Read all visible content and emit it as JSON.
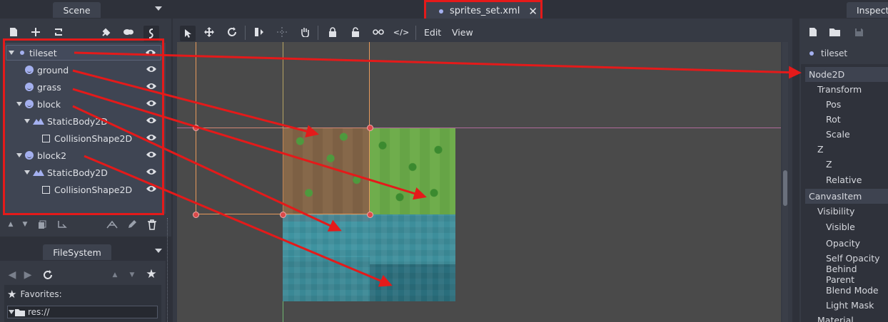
{
  "scene_dock": {
    "tab_label": "Scene",
    "tree": [
      {
        "label": "tileset",
        "icon": "node2d-icon"
      },
      {
        "label": "ground",
        "icon": "sprite-icon"
      },
      {
        "label": "grass",
        "icon": "sprite-icon"
      },
      {
        "label": "block",
        "icon": "sprite-icon"
      },
      {
        "label": "StaticBody2D",
        "icon": "staticbody-icon"
      },
      {
        "label": "CollisionShape2D",
        "icon": "collisionshape-icon"
      },
      {
        "label": "block2",
        "icon": "sprite-icon"
      },
      {
        "label": "StaticBody2D",
        "icon": "staticbody-icon"
      },
      {
        "label": "CollisionShape2D",
        "icon": "collisionshape-icon"
      }
    ]
  },
  "filesystem_dock": {
    "tab_label": "FileSystem",
    "favorites_label": "Favorites:",
    "root_path": "res://"
  },
  "editor": {
    "file_tab": "sprites_set.xml",
    "menus": [
      "Edit",
      "View"
    ]
  },
  "inspector": {
    "tab_label": "Inspect",
    "node_name": "tileset",
    "rows": [
      {
        "label": "Node2D",
        "kind": "category"
      },
      {
        "label": "Transform",
        "kind": "group"
      },
      {
        "label": "Pos",
        "kind": "prop"
      },
      {
        "label": "Rot",
        "kind": "prop"
      },
      {
        "label": "Scale",
        "kind": "prop"
      },
      {
        "label": "Z",
        "kind": "group"
      },
      {
        "label": "Z",
        "kind": "prop"
      },
      {
        "label": "Relative",
        "kind": "prop"
      },
      {
        "label": "CanvasItem",
        "kind": "category"
      },
      {
        "label": "Visibility",
        "kind": "group"
      },
      {
        "label": "Visible",
        "kind": "prop"
      },
      {
        "label": "Opacity",
        "kind": "prop"
      },
      {
        "label": "Self Opacity",
        "kind": "prop"
      },
      {
        "label": "Behind Parent",
        "kind": "prop"
      },
      {
        "label": "Blend Mode",
        "kind": "prop"
      },
      {
        "label": "Light Mask",
        "kind": "prop"
      },
      {
        "label": "Material",
        "kind": "group"
      }
    ]
  },
  "colors": {
    "annotation_red": "#e41a1a",
    "accent": "#a4b0ef"
  }
}
